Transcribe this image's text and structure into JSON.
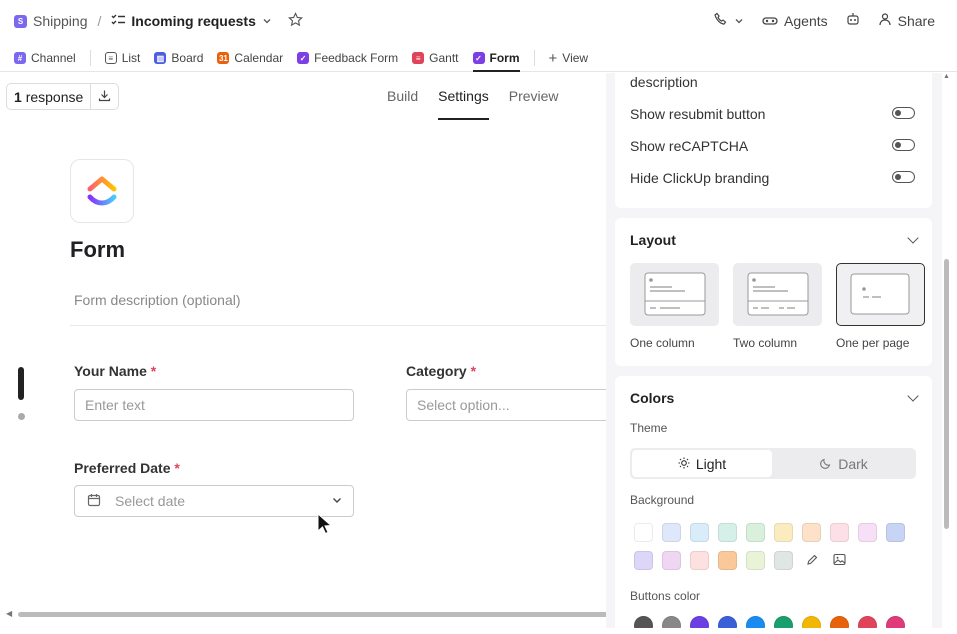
{
  "topbar": {
    "workspace_badge": "S",
    "workspace": "Shipping",
    "separator": "/",
    "list_title": "Incoming requests",
    "agents": "Agents",
    "share": "Share"
  },
  "views": [
    {
      "label": "Channel",
      "icon": "hash-icon",
      "color": "#7b68ee"
    },
    {
      "label": "List",
      "icon": "list-icon",
      "color": "#555555"
    },
    {
      "label": "Board",
      "icon": "board-icon",
      "color": "#4b5fe0"
    },
    {
      "label": "Calendar",
      "icon": "calendar-icon",
      "color": "#e8620c"
    },
    {
      "label": "Feedback Form",
      "icon": "form-icon",
      "color": "#7b3fe4"
    },
    {
      "label": "Gantt",
      "icon": "gantt-icon",
      "color": "#e0445a"
    },
    {
      "label": "Form",
      "icon": "form-icon",
      "color": "#7b3fe4"
    }
  ],
  "add_view": "View",
  "responses": {
    "count": "1",
    "label": "response"
  },
  "form_tabs": [
    "Build",
    "Settings",
    "Preview"
  ],
  "form": {
    "title": "Form",
    "description_placeholder": "Form description (optional)",
    "fields": {
      "name_label": "Your Name",
      "name_placeholder": "Enter text",
      "category_label": "Category",
      "category_placeholder": "Select option...",
      "date_label": "Preferred Date",
      "date_placeholder": "Select date",
      "required_mark": "*"
    }
  },
  "settings": {
    "description_tail": "description",
    "toggles": [
      "Show resubmit button",
      "Show reCAPTCHA",
      "Hide ClickUp branding"
    ],
    "layout": {
      "title": "Layout",
      "options": [
        "One column",
        "Two column",
        "One per page"
      ],
      "selected": "One per page"
    },
    "colors": {
      "title": "Colors",
      "theme_label": "Theme",
      "theme_light": "Light",
      "theme_dark": "Dark",
      "theme_selected": "Light",
      "background_label": "Background",
      "background_swatches": [
        "#ffffff",
        "#dfe7fb",
        "#d8ecfa",
        "#d5f0e8",
        "#d8f0dc",
        "#fbecc0",
        "#fde1c9",
        "#fde0e6",
        "#f6dff7",
        "#c8d4f5",
        "#ddd6f9",
        "#efd6f2",
        "#fde0e0",
        "#fbc89a",
        "#e9f3d8",
        "#dfe6e3"
      ],
      "buttons_label": "Buttons color",
      "button_swatches": [
        "#555555",
        "#888888",
        "#6b3fe4",
        "#3a5fd6",
        "#1a8cf0",
        "#1b9e6e",
        "#f2b705",
        "#e8620c",
        "#e0445a",
        "#e03a7a"
      ]
    }
  }
}
